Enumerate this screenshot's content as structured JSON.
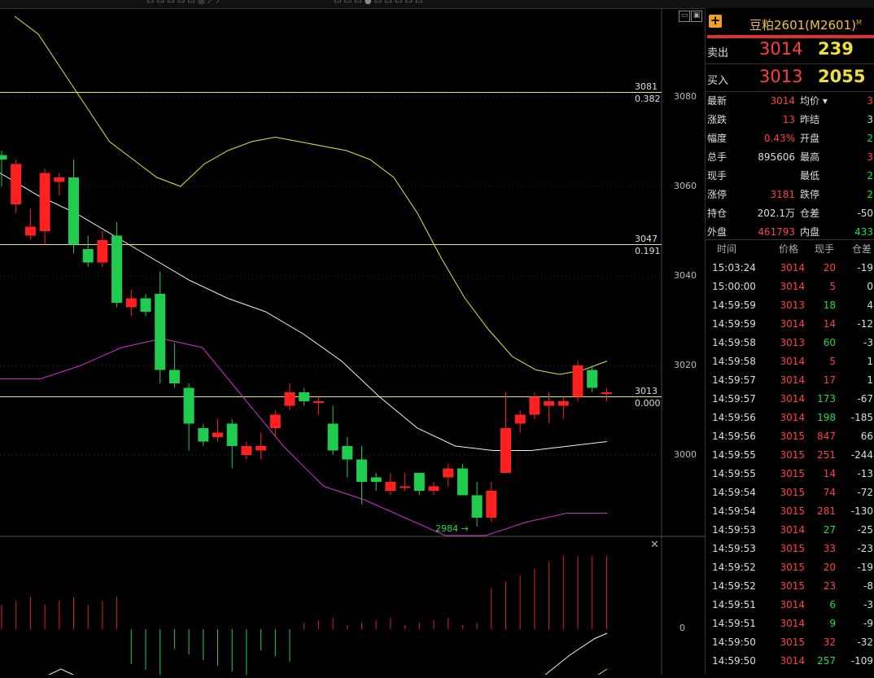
{
  "header": {
    "contract": "豆粕2601(M2601)",
    "contract_mark": "M"
  },
  "quote": {
    "ask_label": "卖出",
    "ask_price": "3014",
    "ask_volume": "239",
    "bid_label": "买入",
    "bid_price": "3013",
    "bid_volume": "2055"
  },
  "stats": [
    {
      "k": "最新",
      "v": "3014",
      "vc": "red",
      "k2": "均价 ▾",
      "v2": "3",
      "v2c": "red"
    },
    {
      "k": "涨跌",
      "v": "13",
      "vc": "red",
      "k2": "昨结",
      "v2": "3",
      "v2c": "white"
    },
    {
      "k": "幅度",
      "v": "0.43%",
      "vc": "red",
      "k2": "开盘",
      "v2": "2",
      "v2c": "green"
    },
    {
      "k": "总手",
      "v": "895606",
      "vc": "white",
      "k2": "最高",
      "v2": "3",
      "v2c": "red"
    },
    {
      "k": "现手",
      "v": "",
      "vc": "white",
      "k2": "最低",
      "v2": "2",
      "v2c": "green"
    },
    {
      "k": "涨停",
      "v": "3181",
      "vc": "red",
      "k2": "跌停",
      "v2": "2",
      "v2c": "green"
    },
    {
      "k": "持仓",
      "v": "202.1万",
      "vc": "white",
      "k2": "仓差",
      "v2": "-50",
      "v2c": "white"
    },
    {
      "k": "外盘",
      "v": "461793",
      "vc": "red",
      "k2": "内盘",
      "v2": "433",
      "v2c": "green"
    }
  ],
  "ticks_header": {
    "time": "时间",
    "price": "价格",
    "hand": "现手",
    "diff": "仓差"
  },
  "ticks": [
    {
      "time": "15:03:24",
      "price": "3014",
      "pc": "red",
      "hand": "20",
      "hc": "red",
      "diff": "-19"
    },
    {
      "time": "15:00:00",
      "price": "3014",
      "pc": "red",
      "hand": "5",
      "hc": "red",
      "diff": "0"
    },
    {
      "time": "14:59:59",
      "price": "3013",
      "pc": "red",
      "hand": "18",
      "hc": "green",
      "diff": "4"
    },
    {
      "time": "14:59:59",
      "price": "3014",
      "pc": "red",
      "hand": "14",
      "hc": "red",
      "diff": "-12"
    },
    {
      "time": "14:59:58",
      "price": "3013",
      "pc": "red",
      "hand": "60",
      "hc": "green",
      "diff": "-3"
    },
    {
      "time": "14:59:58",
      "price": "3014",
      "pc": "red",
      "hand": "5",
      "hc": "red",
      "diff": "1"
    },
    {
      "time": "14:59:57",
      "price": "3014",
      "pc": "red",
      "hand": "17",
      "hc": "red",
      "diff": "1"
    },
    {
      "time": "14:59:57",
      "price": "3014",
      "pc": "red",
      "hand": "173",
      "hc": "green",
      "diff": "-67"
    },
    {
      "time": "14:59:56",
      "price": "3014",
      "pc": "red",
      "hand": "198",
      "hc": "green",
      "diff": "-185"
    },
    {
      "time": "14:59:56",
      "price": "3015",
      "pc": "red",
      "hand": "847",
      "hc": "red",
      "diff": "66"
    },
    {
      "time": "14:59:55",
      "price": "3015",
      "pc": "red",
      "hand": "251",
      "hc": "red",
      "diff": "-244"
    },
    {
      "time": "14:59:55",
      "price": "3015",
      "pc": "red",
      "hand": "14",
      "hc": "red",
      "diff": "-13"
    },
    {
      "time": "14:59:54",
      "price": "3015",
      "pc": "red",
      "hand": "74",
      "hc": "red",
      "diff": "-72"
    },
    {
      "time": "14:59:54",
      "price": "3015",
      "pc": "red",
      "hand": "281",
      "hc": "red",
      "diff": "-130"
    },
    {
      "time": "14:59:53",
      "price": "3014",
      "pc": "red",
      "hand": "27",
      "hc": "green",
      "diff": "-25"
    },
    {
      "time": "14:59:53",
      "price": "3015",
      "pc": "red",
      "hand": "33",
      "hc": "red",
      "diff": "-23"
    },
    {
      "time": "14:59:52",
      "price": "3015",
      "pc": "red",
      "hand": "20",
      "hc": "red",
      "diff": "-19"
    },
    {
      "time": "14:59:52",
      "price": "3015",
      "pc": "red",
      "hand": "23",
      "hc": "red",
      "diff": "-8"
    },
    {
      "time": "14:59:51",
      "price": "3014",
      "pc": "red",
      "hand": "6",
      "hc": "green",
      "diff": "-3"
    },
    {
      "time": "14:59:51",
      "price": "3014",
      "pc": "red",
      "hand": "9",
      "hc": "green",
      "diff": "-9"
    },
    {
      "time": "14:59:50",
      "price": "3015",
      "pc": "red",
      "hand": "32",
      "hc": "red",
      "diff": "-32"
    },
    {
      "time": "14:59:50",
      "price": "3014",
      "pc": "red",
      "hand": "257",
      "hc": "green",
      "diff": "-109"
    }
  ],
  "chart": {
    "y_ticks": [
      "3080",
      "3060",
      "3040",
      "3020",
      "3000"
    ],
    "fib_levels": [
      {
        "price": "3081",
        "ratio": "0.382"
      },
      {
        "price": "3047",
        "ratio": "0.191"
      },
      {
        "price": "3013",
        "ratio": "0.000"
      }
    ],
    "low_marker": "2984",
    "macd_zero": "0"
  },
  "chart_data": {
    "type": "candlestick",
    "ylim": [
      2982,
      3098
    ],
    "candles": [
      {
        "o": 3067,
        "c": 3066,
        "h": 3068,
        "l": 3060
      },
      {
        "o": 3056,
        "c": 3065,
        "h": 3066,
        "l": 3054
      },
      {
        "o": 3049,
        "c": 3051,
        "h": 3055,
        "l": 3048
      },
      {
        "o": 3050,
        "c": 3063,
        "h": 3064,
        "l": 3047
      },
      {
        "o": 3061,
        "c": 3062,
        "h": 3063,
        "l": 3058
      },
      {
        "o": 3062,
        "c": 3047,
        "h": 3066,
        "l": 3045
      },
      {
        "o": 3046,
        "c": 3043,
        "h": 3049,
        "l": 3042
      },
      {
        "o": 3043,
        "c": 3048,
        "h": 3050,
        "l": 3042
      },
      {
        "o": 3049,
        "c": 3034,
        "h": 3052,
        "l": 3033
      },
      {
        "o": 3033,
        "c": 3035,
        "h": 3037,
        "l": 3031
      },
      {
        "o": 3035,
        "c": 3032,
        "h": 3036,
        "l": 3031
      },
      {
        "o": 3036,
        "c": 3019,
        "h": 3041,
        "l": 3016
      },
      {
        "o": 3019,
        "c": 3016,
        "h": 3025,
        "l": 3015
      },
      {
        "o": 3015,
        "c": 3007,
        "h": 3016,
        "l": 3001
      },
      {
        "o": 3006,
        "c": 3003,
        "h": 3007,
        "l": 3002
      },
      {
        "o": 3004,
        "c": 3005,
        "h": 3008,
        "l": 3003
      },
      {
        "o": 3007,
        "c": 3002,
        "h": 3008,
        "l": 2997
      },
      {
        "o": 3000,
        "c": 3002,
        "h": 3003,
        "l": 2999
      },
      {
        "o": 3001,
        "c": 3002,
        "h": 3005,
        "l": 2999
      },
      {
        "o": 3006,
        "c": 3009,
        "h": 3010,
        "l": 3004
      },
      {
        "o": 3011,
        "c": 3014,
        "h": 3016,
        "l": 3010
      },
      {
        "o": 3014,
        "c": 3012,
        "h": 3015,
        "l": 3011
      },
      {
        "o": 3012,
        "c": 3012,
        "h": 3013,
        "l": 3009
      },
      {
        "o": 3007,
        "c": 3001,
        "h": 3011,
        "l": 3000
      },
      {
        "o": 3002,
        "c": 2999,
        "h": 3004,
        "l": 2995
      },
      {
        "o": 2999,
        "c": 2994,
        "h": 3002,
        "l": 2989
      },
      {
        "o": 2995,
        "c": 2994,
        "h": 2996,
        "l": 2992
      },
      {
        "o": 2992,
        "c": 2994,
        "h": 2996,
        "l": 2991
      },
      {
        "o": 2993,
        "c": 2993,
        "h": 2996,
        "l": 2992
      },
      {
        "o": 2996,
        "c": 2992,
        "h": 2996,
        "l": 2991
      },
      {
        "o": 2992,
        "c": 2993,
        "h": 2994,
        "l": 2991
      },
      {
        "o": 2995,
        "c": 2997,
        "h": 2998,
        "l": 2993
      },
      {
        "o": 2997,
        "c": 2991,
        "h": 2998,
        "l": 2991
      },
      {
        "o": 2991,
        "c": 2986,
        "h": 2994,
        "l": 2984
      },
      {
        "o": 2986,
        "c": 2992,
        "h": 2994,
        "l": 2985
      },
      {
        "o": 2996,
        "c": 3006,
        "h": 3014,
        "l": 2996
      },
      {
        "o": 3007,
        "c": 3009,
        "h": 3010,
        "l": 3005
      },
      {
        "o": 3009,
        "c": 3013,
        "h": 3014,
        "l": 3008
      },
      {
        "o": 3011,
        "c": 3012,
        "h": 3014,
        "l": 3007
      },
      {
        "o": 3011,
        "c": 3012,
        "h": 3013,
        "l": 3008
      },
      {
        "o": 3013,
        "c": 3020,
        "h": 3021,
        "l": 3012
      },
      {
        "o": 3019,
        "c": 3015,
        "h": 3020,
        "l": 3014
      },
      {
        "o": 3014,
        "c": 3014,
        "h": 3015,
        "l": 3012
      }
    ],
    "ma_yellow_upper": [
      3098,
      3094,
      3086,
      3078,
      3070,
      3066,
      3062,
      3060,
      3065,
      3068,
      3070,
      3071,
      3070,
      3069,
      3068,
      3066,
      3062,
      3054,
      3044,
      3035,
      3028,
      3022,
      3019,
      3018,
      3019,
      3021
    ],
    "ma_white": [
      3063,
      3058,
      3054,
      3049,
      3044,
      3039,
      3035,
      3032,
      3027,
      3021,
      3013,
      3006,
      3002,
      3001,
      3001,
      3002,
      3003
    ],
    "ma_magenta": [
      3017,
      3017,
      3020,
      3024,
      3026,
      3024,
      3013,
      3002,
      2993,
      2990,
      2986,
      2982,
      2982,
      2985,
      2987,
      2987
    ]
  }
}
